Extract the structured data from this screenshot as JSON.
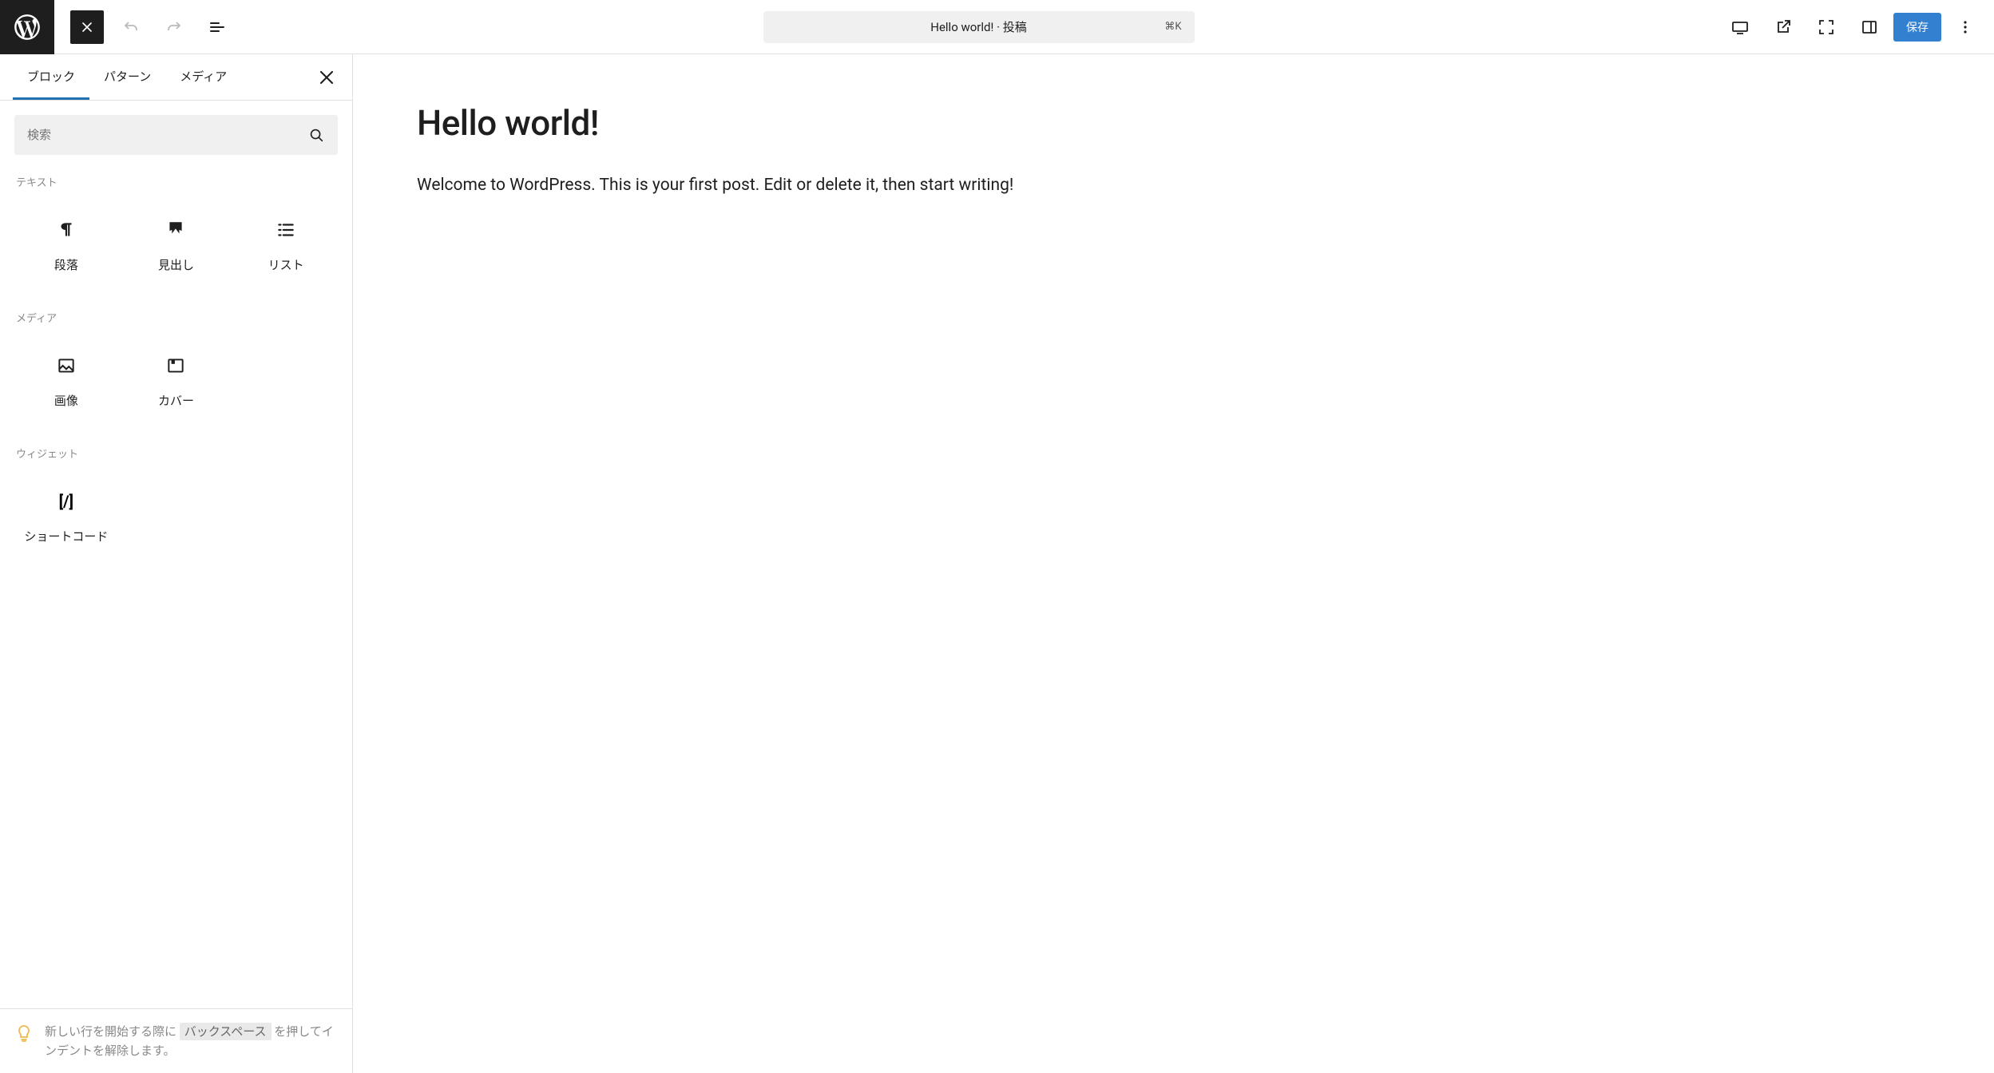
{
  "toolbar": {
    "doc_title": "Hello world! · 投稿",
    "shortcut": "⌘K",
    "save_label": "保存"
  },
  "inserter": {
    "tabs": [
      "ブロック",
      "パターン",
      "メディア"
    ],
    "search_placeholder": "検索",
    "categories": {
      "text": {
        "label": "テキスト",
        "blocks": [
          "段落",
          "見出し",
          "リスト"
        ]
      },
      "media": {
        "label": "メディア",
        "blocks": [
          "画像",
          "カバー"
        ]
      },
      "widgets": {
        "label": "ウィジェット",
        "blocks": [
          "ショートコード"
        ]
      }
    },
    "tip_pre": "新しい行を開始する際に ",
    "tip_kbd": "バックスペース",
    "tip_post": " を押してインデントを解除します。"
  },
  "post": {
    "title": "Hello world!",
    "body": "Welcome to WordPress. This is your first post. Edit or delete it, then start writing!"
  }
}
